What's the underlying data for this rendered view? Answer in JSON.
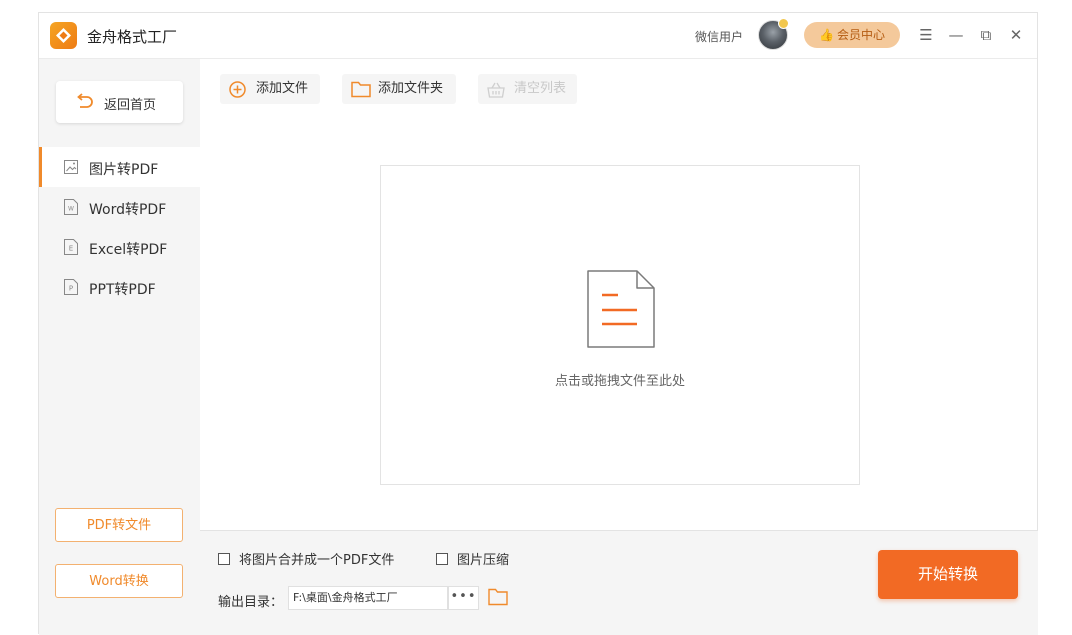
{
  "app": {
    "title": "金舟格式工厂",
    "user_label": "微信用户",
    "vip_label": "会员中心"
  },
  "window_controls": {
    "menu": "☰",
    "minimize": "—",
    "restore": "⧉",
    "close": "✕"
  },
  "sidebar": {
    "back_label": "返回首页",
    "items": [
      {
        "label": "图片转PDF",
        "icon": "image-file-icon",
        "active": true
      },
      {
        "label": "Word转PDF",
        "icon": "word-file-icon",
        "active": false
      },
      {
        "label": "Excel转PDF",
        "icon": "excel-file-icon",
        "active": false
      },
      {
        "label": "PPT转PDF",
        "icon": "ppt-file-icon",
        "active": false
      }
    ],
    "bottom_buttons": [
      "PDF转文件",
      "Word转换"
    ]
  },
  "toolbar": {
    "add_file": "添加文件",
    "add_folder": "添加文件夹",
    "clear_list": "清空列表"
  },
  "dropzone": {
    "hint": "点击或拖拽文件至此处"
  },
  "bottom": {
    "merge_option": "将图片合并成一个PDF文件",
    "compress_option": "图片压缩",
    "merge_checked": false,
    "compress_checked": false,
    "output_label": "输出目录：",
    "output_path": "F:\\桌面\\金舟格式工厂",
    "browse_label": "•••",
    "start_label": "开始转换"
  },
  "colors": {
    "accent": "#f08a2b",
    "start_button": "#f26a24",
    "vip_bg": "#f4c99b",
    "sidebar_bg": "#f5f5f5"
  }
}
